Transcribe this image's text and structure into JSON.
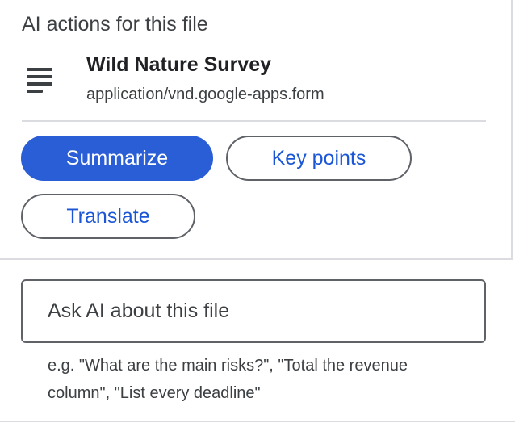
{
  "panel": {
    "title": "AI actions for this file"
  },
  "file": {
    "icon": "form-lines-icon",
    "name": "Wild Nature Survey",
    "mime_type": "application/vnd.google-apps.form"
  },
  "actions": {
    "summarize_label": "Summarize",
    "key_points_label": "Key points",
    "translate_label": "Translate"
  },
  "ask": {
    "placeholder": "Ask AI about this file",
    "value": "",
    "hint": "e.g. \"What are the main risks?\", \"Total the revenue column\", \"List every deadline\""
  },
  "colors": {
    "accent": "#2a5ed6",
    "link_text": "#1a56d6",
    "divider": "#dadce0",
    "outline": "#5f6368"
  }
}
